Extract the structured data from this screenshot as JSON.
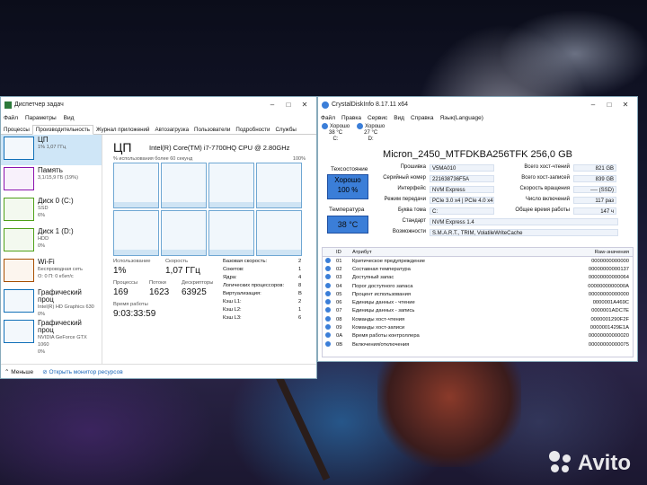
{
  "taskmanager": {
    "title": "Диспетчер задач",
    "menu": [
      "Файл",
      "Параметры",
      "Вид"
    ],
    "tabs": [
      "Процессы",
      "Производительность",
      "Журнал приложений",
      "Автозагрузка",
      "Пользователи",
      "Подробности",
      "Службы"
    ],
    "sidebar": [
      {
        "name": "ЦП",
        "sub": "1% 1,07 ГГц",
        "type": "cpu"
      },
      {
        "name": "Память",
        "sub": "3,1/15,9 ГБ (19%)",
        "type": "mem"
      },
      {
        "name": "Диск 0 (C:)",
        "sub": "SSD",
        "sub2": "6%",
        "type": "disk"
      },
      {
        "name": "Диск 1 (D:)",
        "sub": "HDD",
        "sub2": "0%",
        "type": "disk"
      },
      {
        "name": "Wi-Fi",
        "sub": "Беспроводная сеть",
        "sub2": "О: 0 П: 0 кбит/с",
        "type": "net"
      },
      {
        "name": "Графический проц",
        "sub": "Intel(R) HD Graphics 630",
        "sub2": "0%",
        "type": "gpu"
      },
      {
        "name": "Графический проц",
        "sub": "NVIDIA GeForce GTX 1060",
        "sub2": "0%",
        "type": "gpu"
      }
    ],
    "main": {
      "heading": "ЦП",
      "cpu_name": "Intel(R) Core(TM) i7-7700HQ CPU @ 2.80GHz",
      "usage_label": "% использования более 60 секунд",
      "usage_max": "100%",
      "util_label": "Использование",
      "util_value": "1%",
      "speed_label": "Скорость",
      "speed_value": "1,07 ГГц",
      "proc_label": "Процессы",
      "proc_value": "169",
      "thread_label": "Потоки",
      "thread_value": "1623",
      "handle_label": "Дескрипторы",
      "handle_value": "63925",
      "uptime_label": "Время работы",
      "uptime_value": "9:03:33:59",
      "right": [
        {
          "k": "Базовая скорость:",
          "v": "2"
        },
        {
          "k": "Сокетов:",
          "v": "1"
        },
        {
          "k": "Ядра:",
          "v": "4"
        },
        {
          "k": "Логических процессоров:",
          "v": "8"
        },
        {
          "k": "Виртуализация:",
          "v": "В"
        },
        {
          "k": "Кэш L1:",
          "v": "2"
        },
        {
          "k": "Кэш L2:",
          "v": "1"
        },
        {
          "k": "Кэш L3:",
          "v": "6"
        }
      ]
    },
    "bottom": {
      "less": "Меньше",
      "monitor": "Открыть монитор ресурсов"
    }
  },
  "cdi": {
    "title": "CrystalDiskInfo 8.17.11 x64",
    "menu": [
      "Файл",
      "Правка",
      "Сервис",
      "Вид",
      "Справка",
      "Язык(Language)"
    ],
    "drives": [
      {
        "status": "Хорошо",
        "temp": "38 °C",
        "letter": "C:"
      },
      {
        "status": "Хорошо",
        "temp": "27 °C",
        "letter": "D:"
      }
    ],
    "model": "Micron_2450_MTFDKBA256TFK 256,0 GB",
    "health_label": "Техсостояние",
    "health_status": "Хорошо",
    "health_pct": "100 %",
    "temp_label": "Температура",
    "temp_value": "38 °C",
    "left_kv": [
      {
        "k": "Прошивка",
        "v": "V5MA010"
      },
      {
        "k": "Серийный номер",
        "v": "221638736F5A"
      },
      {
        "k": "Интерфейс",
        "v": "NVM Express"
      },
      {
        "k": "Режим передачи",
        "v": "PCIe 3.0 x4 | PCIe 4.0 x4"
      },
      {
        "k": "Буква тома",
        "v": "C:"
      },
      {
        "k": "Стандарт",
        "v": "NVM Express 1.4"
      },
      {
        "k": "Возможности",
        "v": "S.M.A.R.T., TRIM, VolatileWriteCache"
      }
    ],
    "right_kv": [
      {
        "k": "Всего хост-чтений",
        "v": "821 GB"
      },
      {
        "k": "Всего хост-записей",
        "v": "839 GB"
      },
      {
        "k": "Скорость вращения",
        "v": "---- (SSD)"
      },
      {
        "k": "Число включений",
        "v": "117 раз"
      },
      {
        "k": "Общее время работы",
        "v": "147 ч"
      }
    ],
    "columns": {
      "id": "ID",
      "attr": "Атрибут",
      "raw": "Raw-значения"
    },
    "rows": [
      {
        "id": "01",
        "attr": "Критическое предупреждение",
        "raw": "0000000000000"
      },
      {
        "id": "02",
        "attr": "Составная температура",
        "raw": "00000000000137"
      },
      {
        "id": "03",
        "attr": "Доступный запас",
        "raw": "00000000000064"
      },
      {
        "id": "04",
        "attr": "Порог доступного запаса",
        "raw": "0000000000000A"
      },
      {
        "id": "05",
        "attr": "Процент использования",
        "raw": "00000000000000"
      },
      {
        "id": "06",
        "attr": "Единицы данных - чтение",
        "raw": "0000001A469C"
      },
      {
        "id": "07",
        "attr": "Единицы данных - запись",
        "raw": "0000001ADC7E"
      },
      {
        "id": "08",
        "attr": "Команды хост-чтения",
        "raw": "0000001290F2F"
      },
      {
        "id": "09",
        "attr": "Команды хост-записи",
        "raw": "0000001429E1A"
      },
      {
        "id": "0A",
        "attr": "Время работы контроллера",
        "raw": "00000000000020"
      },
      {
        "id": "0B",
        "attr": "Включения/отключения",
        "raw": "00000000000075"
      }
    ]
  },
  "watermark": "Avito"
}
